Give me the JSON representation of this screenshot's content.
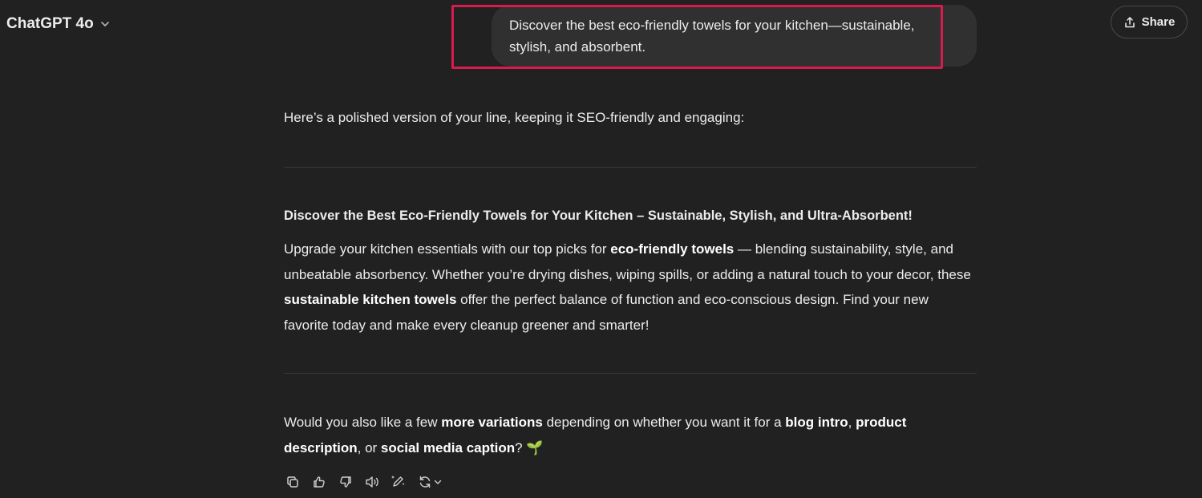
{
  "header": {
    "model_label": "ChatGPT 4o",
    "share_label": "Share"
  },
  "user_message": {
    "text": "Discover the best eco-friendly towels for your kitchen—sustainable, stylish, and absorbent."
  },
  "assistant": {
    "intro": "Here’s a polished version of your line, keeping it SEO-friendly and engaging:",
    "heading": "Discover the Best Eco-Friendly Towels for Your Kitchen – Sustainable, Stylish, and Ultra-Absorbent!",
    "paragraph": {
      "p1": "Upgrade your kitchen essentials with our top picks for ",
      "b1": "eco-friendly towels",
      "p2": " — blending sustainability, style, and unbeatable absorbency. Whether you’re drying dishes, wiping spills, or adding a natural touch to your decor, these ",
      "b2": "sustainable kitchen towels",
      "p3": " offer the perfect balance of function and eco-conscious design. Find your new favorite today and make every cleanup greener and smarter!"
    },
    "question": {
      "p1": "Would you also like a few ",
      "b1": "more variations",
      "p2": " depending on whether you want it for a ",
      "b2": "blog intro",
      "p3": ", ",
      "b3": "product description",
      "p4": ", or ",
      "b4": "social media caption",
      "p5": "? ",
      "emoji": "🌱"
    }
  },
  "actions": [
    {
      "icon": "copy-icon"
    },
    {
      "icon": "thumbs-up-icon"
    },
    {
      "icon": "thumbs-down-icon"
    },
    {
      "icon": "read-aloud-icon"
    },
    {
      "icon": "edit-canvas-icon"
    },
    {
      "icon": "regenerate-icon"
    }
  ],
  "colors": {
    "background": "#212121",
    "bubble": "#303030",
    "highlight": "#d81b4f",
    "text": "#ececec"
  }
}
